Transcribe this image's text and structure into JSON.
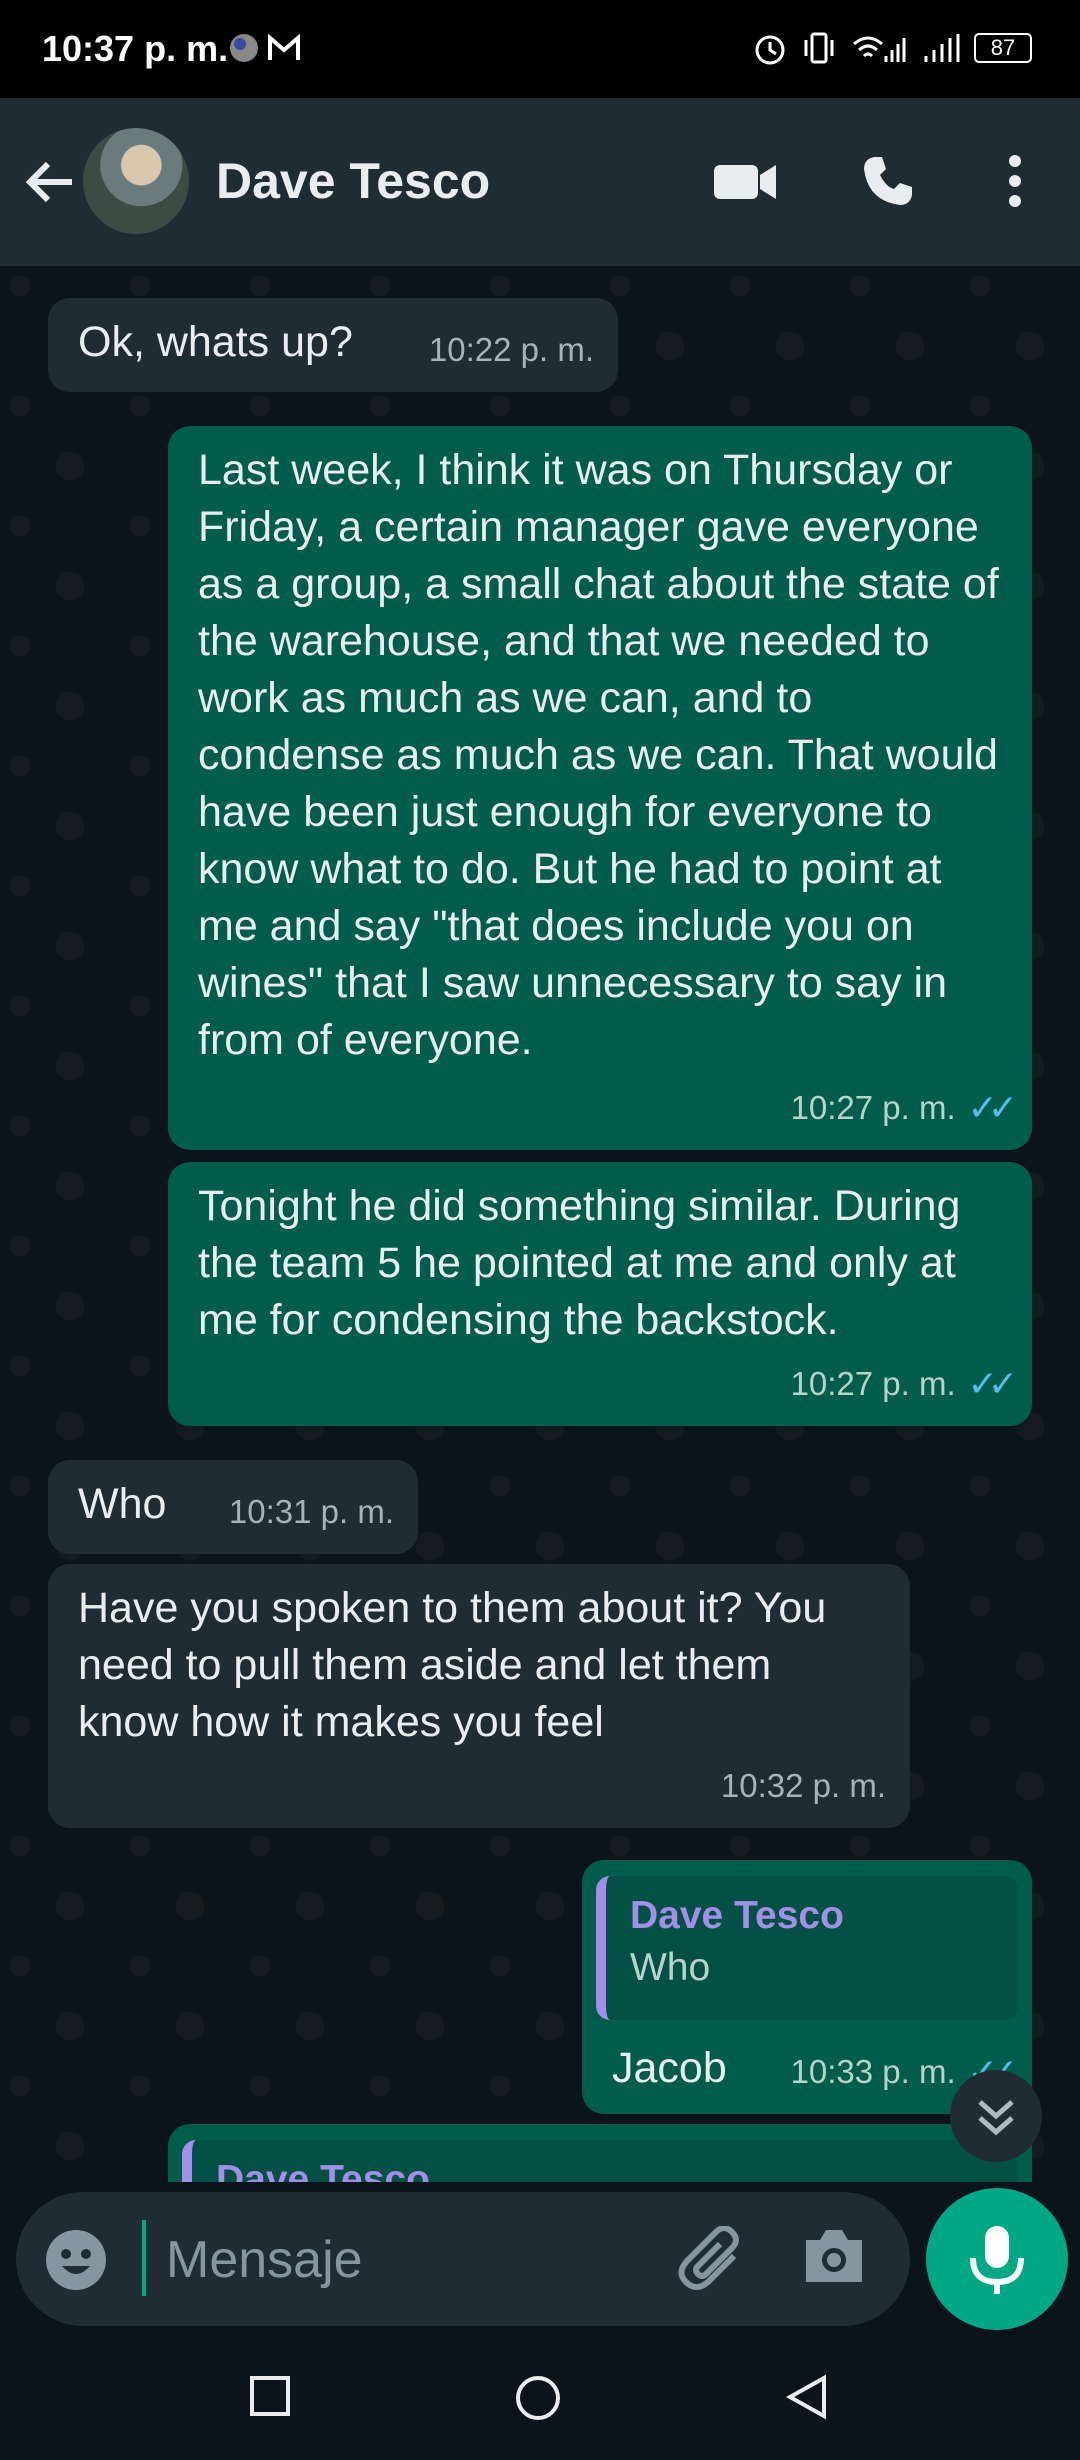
{
  "status_bar": {
    "time": "10:37 p. m.",
    "battery": "87"
  },
  "header": {
    "contact_name": "Dave Tesco"
  },
  "messages": [
    {
      "direction": "in",
      "text": "Ok, whats up?",
      "time": "10:22 p. m."
    },
    {
      "direction": "out",
      "text": "Last week, I think it was on Thursday or Friday, a certain manager gave everyone as a group, a small chat about the state of the warehouse, and that we needed to work as much as we can, and to condense as much as we can. That would have been just enough for everyone to know what to do. But he had to point at me and say \"that does include you on wines\" that I saw unnecessary to say in from of everyone.",
      "time": "10:27 p. m.",
      "ticks": "✓✓"
    },
    {
      "direction": "out",
      "text": "Tonight he did something similar. During the team 5 he pointed at me and only at me for condensing the backstock.",
      "time": "10:27 p. m.",
      "ticks": "✓✓"
    },
    {
      "direction": "in",
      "text": "Who",
      "time": "10:31 p. m."
    },
    {
      "direction": "in",
      "text": "Have you spoken to them about it? You need to pull them aside and let them know how it makes you feel",
      "time": "10:32 p. m."
    },
    {
      "direction": "out",
      "quote": {
        "name": "Dave Tesco",
        "text": "Who"
      },
      "text": "Jacob",
      "time": "10:33 p. m.",
      "ticks": "✓✓"
    },
    {
      "direction": "out",
      "quote": {
        "name": "Dave Tesco"
      }
    }
  ],
  "composer": {
    "placeholder": "Mensaje"
  },
  "colors": {
    "accent": "#00a884",
    "outgoing": "#005c4b",
    "incoming": "#1f2c34",
    "read_ticks": "#53bdeb",
    "quote_name": "#a38ee8"
  }
}
